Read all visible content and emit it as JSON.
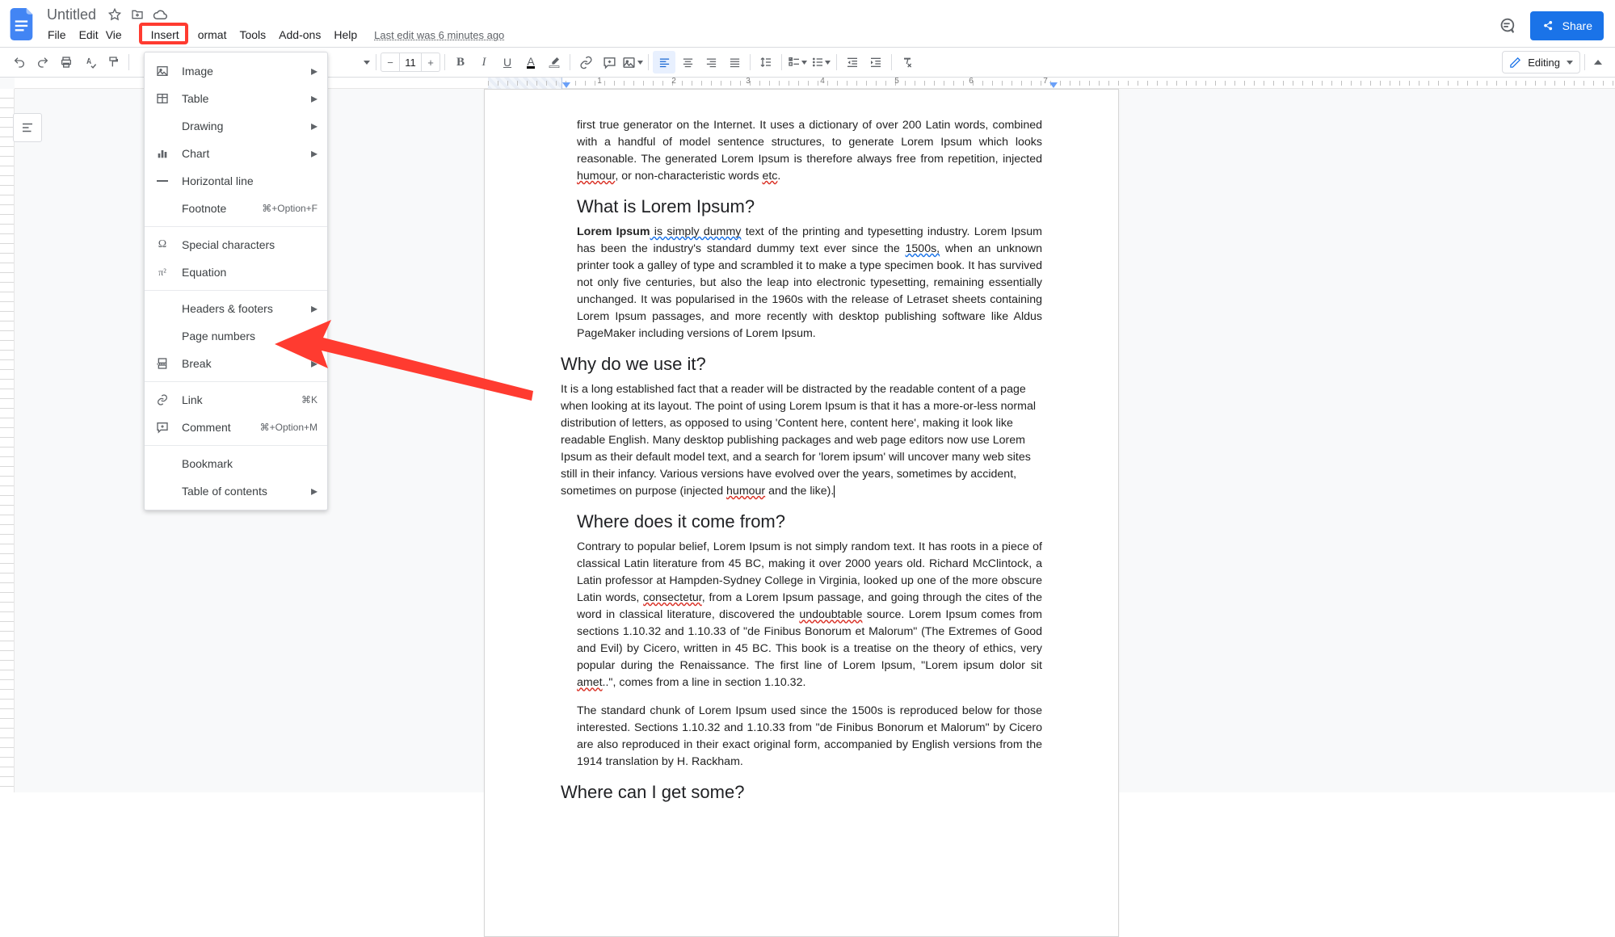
{
  "doc_title": "Untitled",
  "menubar": {
    "file": "File",
    "edit": "Edit",
    "view_partial": "Vie",
    "insert": "Insert",
    "format_partial": "ormat",
    "tools": "Tools",
    "addons": "Add-ons",
    "help": "Help",
    "last_edit": "Last edit was 6 minutes ago"
  },
  "share_label": "Share",
  "font_size": "11",
  "editing_label": "Editing",
  "ruler_numbers": [
    "1",
    "2",
    "3",
    "4",
    "5",
    "6",
    "7"
  ],
  "insert_menu": {
    "image": "Image",
    "table": "Table",
    "drawing": "Drawing",
    "chart": "Chart",
    "horizontal_line": "Horizontal line",
    "footnote": "Footnote",
    "footnote_short": "⌘+Option+F",
    "special_chars": "Special characters",
    "equation": "Equation",
    "headers_footers": "Headers & footers",
    "page_numbers": "Page numbers",
    "break": "Break",
    "link": "Link",
    "link_short": "⌘K",
    "comment": "Comment",
    "comment_short": "⌘+Option+M",
    "bookmark": "Bookmark",
    "toc": "Table of contents"
  },
  "content": {
    "p0a": "first true generator on the Internet. It uses a dictionary of over 200 Latin words, combined with a handful of model sentence structures, to generate Lorem Ipsum which looks reasonable. The generated Lorem Ipsum is therefore always free from repetition, injected ",
    "p0_h": "humour",
    "p0b": ", or non-characteristic words ",
    "p0_etc": "etc",
    "p0c": ".",
    "h1": "What is Lorem Ipsum?",
    "p1a": "Lorem Ipsum",
    "p1b": " is simply dummy",
    "p1c": " text of the printing and typesetting industry. Lorem Ipsum has been the industry's standard dummy text ever since the ",
    "p1d": "1500s,",
    "p1e": " when an unknown printer took a galley of type and scrambled it to make a type specimen book. It has survived not only five centuries, but also the leap into electronic typesetting, remaining essentially unchanged. It was popularised in the 1960s with the release of Letraset sheets containing Lorem Ipsum passages, and more recently with desktop publishing software like Aldus PageMaker including versions of Lorem Ipsum.",
    "h2": "Why do we use it?",
    "p2a": "It is a long established fact that a reader will be distracted by the readable content of a page when looking at its layout. The point of using Lorem Ipsum is that it has a more-or-less normal distribution of letters, as opposed to using 'Content here, content here', making it look like readable English. Many desktop publishing packages and web page editors now use Lorem Ipsum as their default model text, and a search for 'lorem ipsum' will uncover many web sites still in their infancy. Various versions have evolved over the years, sometimes by accident, sometimes on purpose (injected ",
    "p2b": "humour",
    "p2c": " and the like).",
    "h3": "Where does it come from?",
    "p3a": "Contrary to popular belief, Lorem Ipsum is not simply random text. It has roots in a piece of classical Latin literature from 45 BC, making it over 2000 years old. Richard McClintock, a Latin professor at Hampden-Sydney College in Virginia, looked up one of the more obscure Latin words, ",
    "p3b": "consectetur",
    "p3c": ", from a Lorem Ipsum passage, and going through the cites of the word in classical literature, discovered the ",
    "p3d": "undoubtable",
    "p3e": " source. Lorem Ipsum comes from sections 1.10.32 and 1.10.33 of \"de Finibus Bonorum et Malorum\" (The Extremes of Good and Evil) by Cicero, written in 45 BC. This book is a treatise on the theory of ethics, very popular during the Renaissance. The first line of Lorem Ipsum, \"Lorem ipsum dolor sit ",
    "p3f": "amet",
    "p3g": "..\", comes from a line in section 1.10.32.",
    "p4": "The standard chunk of Lorem Ipsum used since the 1500s is reproduced below for those interested. Sections 1.10.32 and 1.10.33 from \"de Finibus Bonorum et Malorum\" by Cicero are also reproduced in their exact original form, accompanied by English versions from the 1914 translation by H. Rackham.",
    "h4": "Where can I get some?"
  }
}
